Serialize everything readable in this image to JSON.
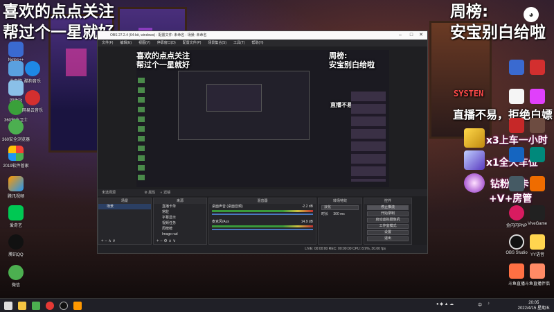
{
  "overlay": {
    "top_left_line1": "喜欢的点点关注",
    "top_left_line2": "帮过个一星就好",
    "top_right_line1": "周榜:",
    "top_right_line2": "安宝别白给啦",
    "right_notice": "直播不易，拒绝白嫖",
    "gift_lines": [
      "x3上车一小时",
      "x1全天车位",
      "钻粉周卡",
      "+V+房管"
    ]
  },
  "desktop_left": {
    "labels": [
      "Notes++",
      "此电脑",
      "回收站",
      "酷狗音乐",
      "360安全卫士",
      "网易云音乐",
      "360安全浏览器",
      "",
      "2019软件管家",
      "腾讯视频",
      "爱奇艺",
      "腾讯QQ",
      "微信"
    ]
  },
  "desktop_right": {
    "labels": [
      "",
      "",
      "",
      "",
      "",
      "",
      "",
      "",
      "",
      "",
      "",
      "",
      "金闪闪PNP",
      "ViveGame",
      "OBS Studio",
      "YY语音",
      "斗鱼直播",
      "斗鱼直播伴侣"
    ],
    "systen_text": "SYSTEN"
  },
  "obs": {
    "title": "OBS 27.2.4 (64-bit, windows) - 配置文件: 未命名 - 场景: 未命名",
    "menu": [
      "文件(F)",
      "编辑(E)",
      "视图(V)",
      "停靠窗口(D)",
      "配置文件(P)",
      "场景集合(S)",
      "工具(T)",
      "帮助(H)"
    ],
    "status_line": "未选择源",
    "status_props": "属性",
    "status_filters": "滤镜",
    "docks": {
      "scenes": {
        "header": "场景",
        "items": [
          "场景"
        ]
      },
      "sources": {
        "header": "来源",
        "items": [
          "直播卡单",
          "常駐",
          "字幕显示",
          "视频任务",
          "周榜榜",
          "Image rad"
        ]
      },
      "mixer": {
        "header": "混音器",
        "tracks": [
          {
            "name": "桌面声音 (桌面音频)",
            "db": "-2.2 dB"
          },
          {
            "name": "麦克风/Aux",
            "db": "14.9 dB"
          }
        ]
      },
      "transitions": {
        "header": "转场特效",
        "type": "淡化",
        "duration_label": "时长",
        "duration": "300 ms"
      },
      "controls": {
        "header": "控件",
        "buttons": [
          "停止推流",
          "开始录制",
          "启动虚拟摄像机",
          "工作室模式",
          "设置",
          "退出"
        ]
      }
    },
    "statusbar": "LIVE: 00:00:00   REC: 00:00:00   CPU: 8.9%, 30.00 fps"
  },
  "taskbar": {
    "tray_text": "中",
    "time": "20:05",
    "date": "2022/4/15 星期五"
  },
  "colors": {
    "accent_pink": "#ff3fae",
    "selection": "#2b3f63",
    "meter_green": "#3a9a3a"
  }
}
